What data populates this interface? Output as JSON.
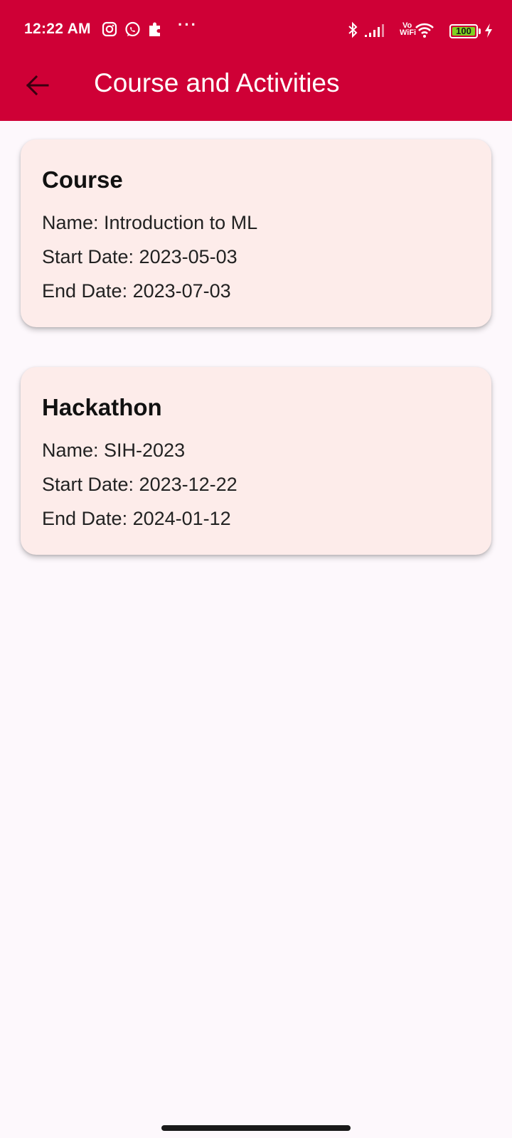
{
  "status_bar": {
    "time": "12:22 AM",
    "left_icons": [
      "instagram-icon",
      "whatsapp-icon",
      "puzzle-icon"
    ],
    "more": "···",
    "right_icons": [
      "bluetooth-icon",
      "signal-icon",
      "vowifi-icon",
      "wifi-icon",
      "battery-icon",
      "charging-icon"
    ],
    "vowifi_top": "Vo",
    "vowifi_bottom": "WiFi",
    "battery_level": "100",
    "battery_percent": 100
  },
  "header": {
    "title": "Course and Activities",
    "back_icon": "arrow-left-icon",
    "bg_color": "#cf0036"
  },
  "cards": [
    {
      "heading": "Course",
      "name": "Name: Introduction to ML",
      "start": "Start Date: 2023-05-03",
      "end": "End Date: 2023-07-03"
    },
    {
      "heading": "Hackathon",
      "name": "Name: SIH-2023",
      "start": "Start Date: 2023-12-22",
      "end": "End Date: 2024-01-12"
    }
  ],
  "colors": {
    "card_bg": "#fdecea",
    "page_bg": "#fdf8fc"
  }
}
